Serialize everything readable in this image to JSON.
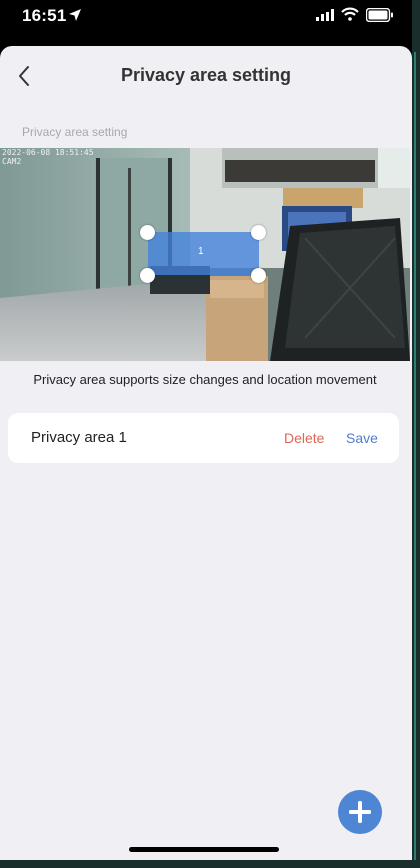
{
  "status_bar": {
    "time": "16:51"
  },
  "nav": {
    "title": "Privacy area setting",
    "back_icon": "chevron-left-icon"
  },
  "section_label": "Privacy area setting",
  "camera": {
    "osd_lines": [
      "2022-06-08 18:51:45",
      "CAM2"
    ],
    "privacy_box_index": "1",
    "privacy_box_color": "#4282dc"
  },
  "caption": "Privacy area supports size changes and location movement",
  "areas": [
    {
      "name": "Privacy area 1",
      "delete_label": "Delete",
      "save_label": "Save"
    }
  ],
  "colors": {
    "delete": "#e06656",
    "save": "#4c7ec8",
    "add_button": "#4e85d4",
    "background": "#efeff4"
  },
  "add_button_icon": "plus-icon"
}
